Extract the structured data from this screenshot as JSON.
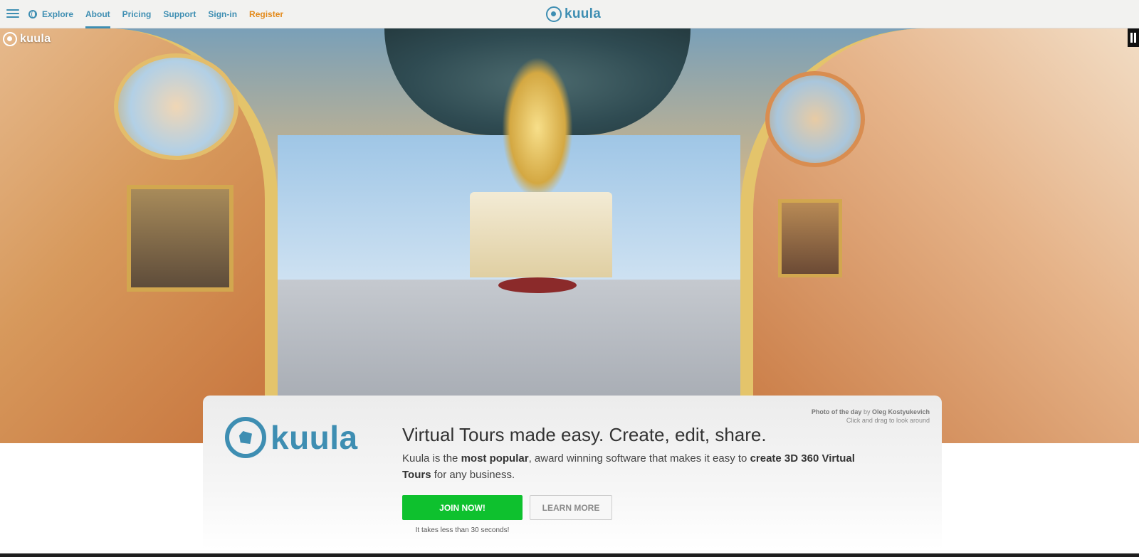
{
  "nav": {
    "items": [
      {
        "label": "Explore"
      },
      {
        "label": "About"
      },
      {
        "label": "Pricing"
      },
      {
        "label": "Support"
      },
      {
        "label": "Sign-in"
      },
      {
        "label": "Register"
      }
    ],
    "active": "About"
  },
  "brand": {
    "name": "kuula",
    "color": "#3e8eb2"
  },
  "hero": {
    "credit_label": "Photo of the day",
    "credit_by": "by",
    "credit_author": "Oleg Kostyukevich",
    "hint": "Click and drag to look around"
  },
  "card": {
    "headline": "Virtual Tours made easy. Create, edit, share.",
    "desc_1": "Kuula is the ",
    "desc_bold_1": "most popular",
    "desc_2": ", award winning software that makes it easy to ",
    "desc_bold_2": "create 3D 360 Virtual Tours",
    "desc_3": " for any business.",
    "join_label": "JOIN NOW!",
    "learn_label": "LEARN MORE",
    "note": "It takes less than 30 seconds!"
  },
  "colors": {
    "accent": "#3e8eb2",
    "register": "#e38a1b",
    "join": "#0ec12e"
  },
  "icons": [
    "menu-icon",
    "globe-icon",
    "pause-icon"
  ]
}
